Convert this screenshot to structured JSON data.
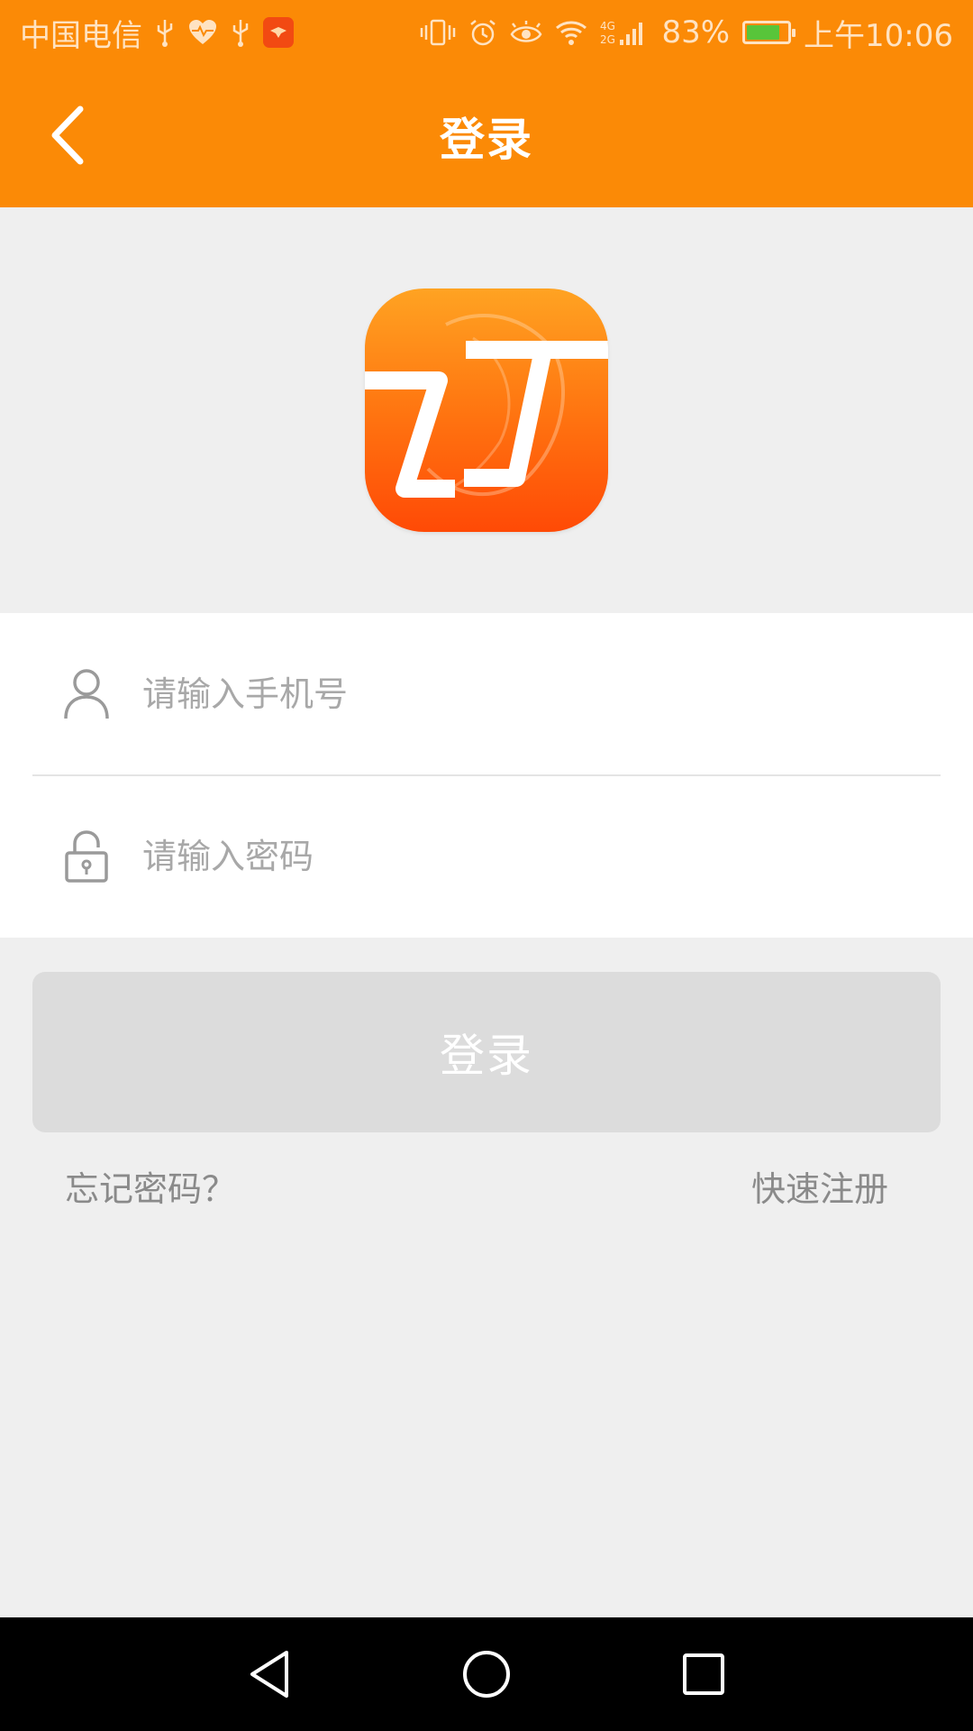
{
  "status_bar": {
    "carrier": "中国电信",
    "network": "4G 2G",
    "battery_percent": "83%",
    "battery_level": 0.83,
    "time": "上午10:06",
    "icons": [
      "usb-icon",
      "heart-rate-icon",
      "usb-icon",
      "app-notification-icon",
      "vibrate-icon",
      "alarm-icon",
      "eye-icon",
      "wifi-icon",
      "signal-icon",
      "battery-charging-icon"
    ]
  },
  "header": {
    "title": "登录",
    "back_icon": "chevron-left-icon"
  },
  "logo": {
    "text": "订",
    "icon": "app-logo-icon"
  },
  "form": {
    "phone": {
      "placeholder": "请输入手机号",
      "value": "",
      "icon": "user-icon"
    },
    "password": {
      "placeholder": "请输入密码",
      "value": "",
      "icon": "lock-icon"
    }
  },
  "login_button": {
    "label": "登录",
    "enabled": false
  },
  "links": {
    "forgot_password": "忘记密码？",
    "quick_register": "快速注册"
  },
  "colors": {
    "primary": "#fb8a06",
    "background": "#efefef",
    "button_disabled": "#dcdcdc",
    "link_text": "#8a8a8a",
    "placeholder": "#a8a8a8"
  }
}
